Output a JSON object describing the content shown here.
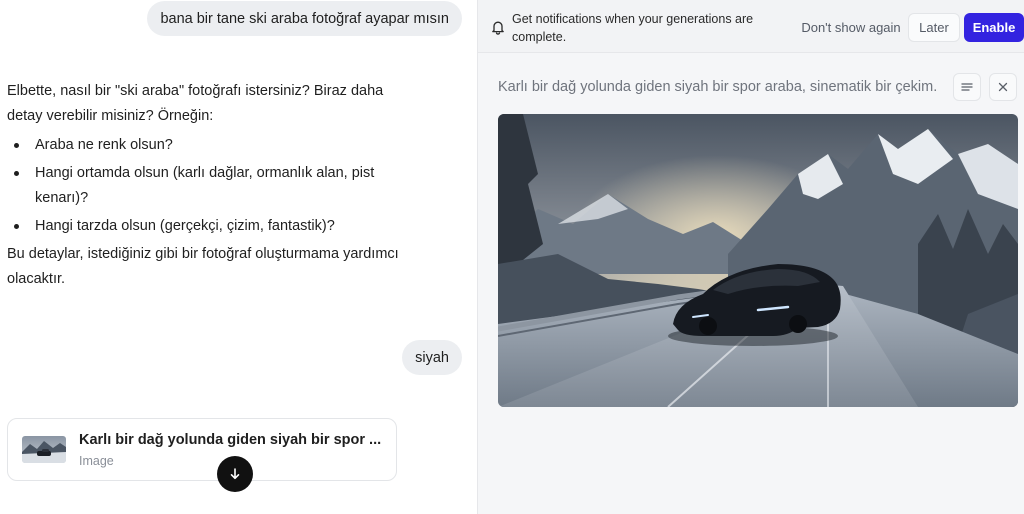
{
  "chat": {
    "user_message_1": "bana bir tane ski araba fotoğraf ayapar mısın",
    "assistant_intro": "Elbette, nasıl bir \"ski araba\" fotoğrafı istersiniz? Biraz daha detay verebilir misiniz? Örneğin:",
    "assistant_bullets": [
      "Araba ne renk olsun?",
      "Hangi ortamda olsun (karlı dağlar, ormanlık alan, pist kenarı)?",
      "Hangi tarzda olsun (gerçekçi, çizim, fantastik)?"
    ],
    "assistant_outro": "Bu detaylar, istediğiniz gibi bir fotoğraf oluşturmama yardımcı olacaktır.",
    "user_message_2": "siyah",
    "image_card": {
      "title": "Karlı bir dağ yolunda giden siyah bir spor ...",
      "subtitle": "Image"
    }
  },
  "notification": {
    "message": "Get notifications when your generations are complete.",
    "dont_show_label": "Don't show again",
    "later_label": "Later",
    "enable_label": "Enable"
  },
  "panel": {
    "prompt": "Karlı bir dağ yolunda giden siyah bir spor araba, sinematik bir çekim."
  },
  "icons": [
    "bell-icon",
    "menu-icon",
    "close-icon",
    "arrow-down-icon"
  ],
  "colors": {
    "accent": "#3323e0",
    "user_bubble": "#eceef1",
    "panel_bg": "#f5f6f8",
    "muted_text": "#6f747d"
  }
}
